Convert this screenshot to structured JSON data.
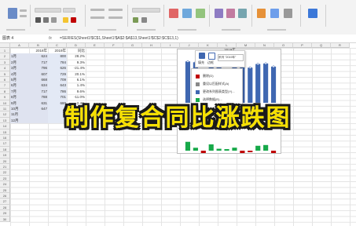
{
  "formula_bar": {
    "name_box": "图表 4",
    "fx": "fx",
    "formula": "=SERIES(Sheet1!$C$1,Sheet1!$A$2:$A$13,Sheet1!$C$2:$C$13,1)"
  },
  "columns": [
    "A",
    "B",
    "C",
    "D",
    "E",
    "F",
    "G",
    "H",
    "I",
    "J",
    "K",
    "L",
    "M",
    "N",
    "O",
    "P",
    "Q",
    "R"
  ],
  "rows": [
    "1",
    "2",
    "3",
    "4",
    "5",
    "6",
    "7",
    "8",
    "9",
    "10",
    "11",
    "12",
    "13",
    "14",
    "15",
    "16",
    "17",
    "18",
    "19",
    "20",
    "21",
    "22",
    "23",
    "24",
    "25",
    "26",
    "27",
    "28",
    "29",
    "30"
  ],
  "table": {
    "headers": [
      "",
      "2018年",
      "2019年",
      "同比"
    ],
    "rows": [
      [
        "1月",
        "624",
        "800",
        "28.2%"
      ],
      [
        "2月",
        "717",
        "784",
        "9.3%"
      ],
      [
        "3月",
        "796",
        "626",
        "-21.4%"
      ],
      [
        "4月",
        "607",
        "729",
        "20.1%"
      ],
      [
        "5月",
        "668",
        "709",
        "6.1%"
      ],
      [
        "6月",
        "634",
        "643",
        "1.4%"
      ],
      [
        "7月",
        "717",
        "786",
        "9.6%"
      ],
      [
        "8月",
        "788",
        "701",
        "-11.0%"
      ],
      [
        "9月",
        "631",
        "680",
        "-2.4%"
      ],
      [
        "10月",
        "647",
        "",
        "15.6%"
      ],
      [
        "11月",
        "",
        "",
        ""
      ],
      [
        "12月",
        "",
        "",
        ""
      ]
    ]
  },
  "chart": {
    "title": "2019年",
    "bar_color": "#3f67b1",
    "up_color": "#17a94a",
    "down_color": "#c00000"
  },
  "chart_data": {
    "type": "bar",
    "categories": [
      "1月",
      "2月",
      "3月",
      "4月",
      "5月",
      "6月",
      "7月",
      "8月",
      "9月",
      "10月",
      "11月",
      "12月"
    ],
    "series": [
      {
        "name": "2019年",
        "values": [
          800,
          784,
          626,
          729,
          709,
          643,
          786,
          701,
          680,
          750,
          760,
          700
        ]
      }
    ],
    "change_values": [
      28.2,
      9.3,
      -21.4,
      20.1,
      6.1,
      1.4,
      9.6,
      -11.0,
      -2.4,
      15.6,
      18.0,
      -9.0
    ]
  },
  "mini_toolbar": {
    "fill_label": "填充",
    "outline_label": "边框",
    "series_label": "系列 \"2019年\""
  },
  "context_menu": {
    "items": [
      "删除(D)",
      "重设以匹配样式(A)",
      "更改系列图表类型(Y)...",
      "选择数据(E)..."
    ]
  },
  "banner": {
    "text": "制作复合同比涨跌图"
  }
}
